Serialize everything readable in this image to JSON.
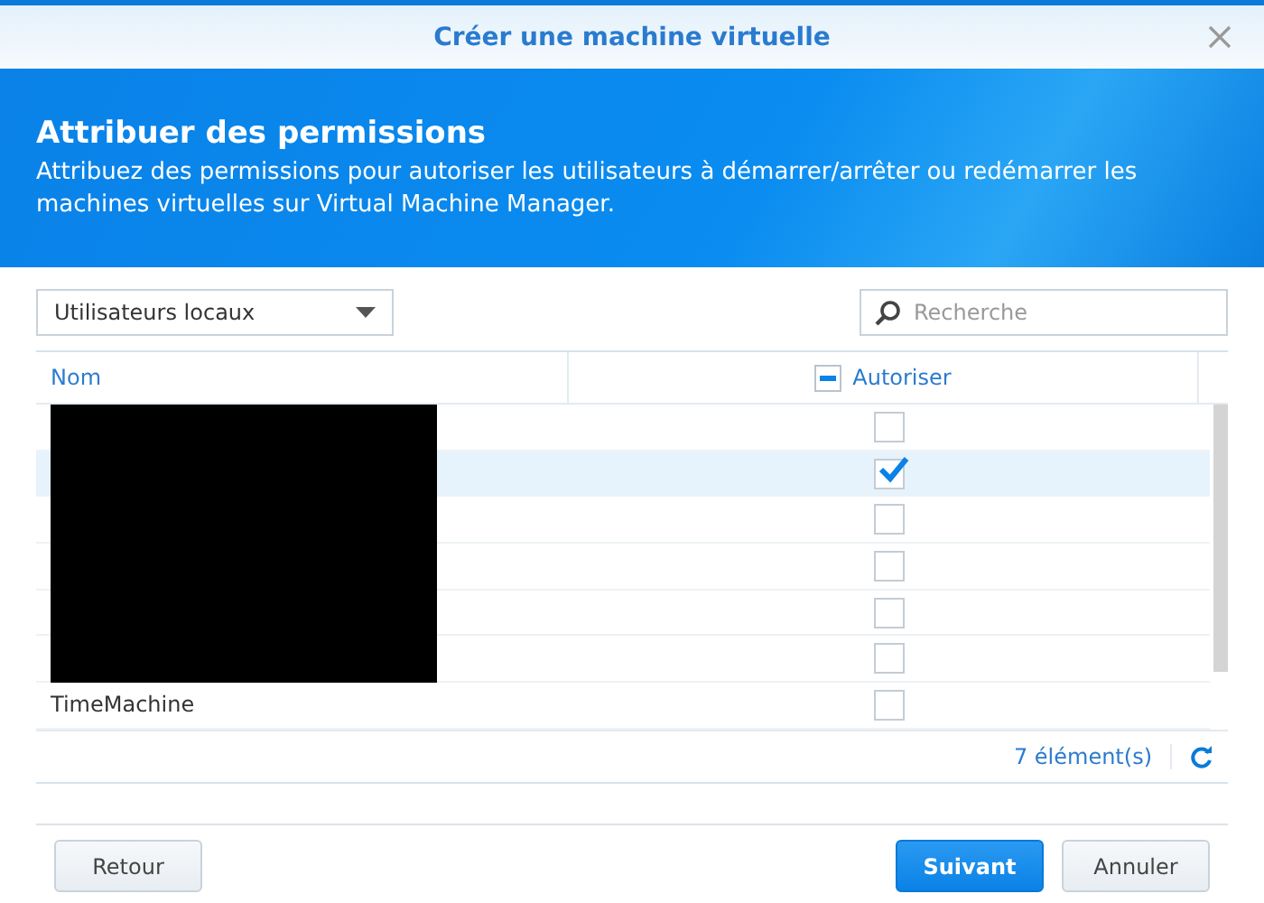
{
  "window": {
    "title": "Créer une machine virtuelle"
  },
  "banner": {
    "title": "Attribuer des permissions",
    "description": "Attribuez des permissions pour autoriser les utilisateurs à démarrer/arrêter ou redémarrer les machines virtuelles sur Virtual Machine Manager."
  },
  "filter": {
    "value": "Utilisateurs locaux"
  },
  "search": {
    "placeholder": "Recherche"
  },
  "table": {
    "columns": [
      {
        "label": "Nom"
      },
      {
        "label": "Autoriser",
        "indeterminate": true
      }
    ],
    "rows": [
      {
        "checked": false,
        "selected": false,
        "redacted": true
      },
      {
        "checked": true,
        "selected": true,
        "redacted": true
      },
      {
        "checked": false,
        "selected": false,
        "redacted": true
      },
      {
        "checked": false,
        "selected": false,
        "redacted": true
      },
      {
        "checked": false,
        "selected": false,
        "redacted": true
      },
      {
        "checked": false,
        "selected": false,
        "redacted": true
      },
      {
        "name": "TimeMachine",
        "checked": false,
        "selected": false,
        "redacted": false
      }
    ]
  },
  "count": "7 élément(s)",
  "buttons": {
    "back": "Retour",
    "next": "Suivant",
    "cancel": "Annuler"
  }
}
